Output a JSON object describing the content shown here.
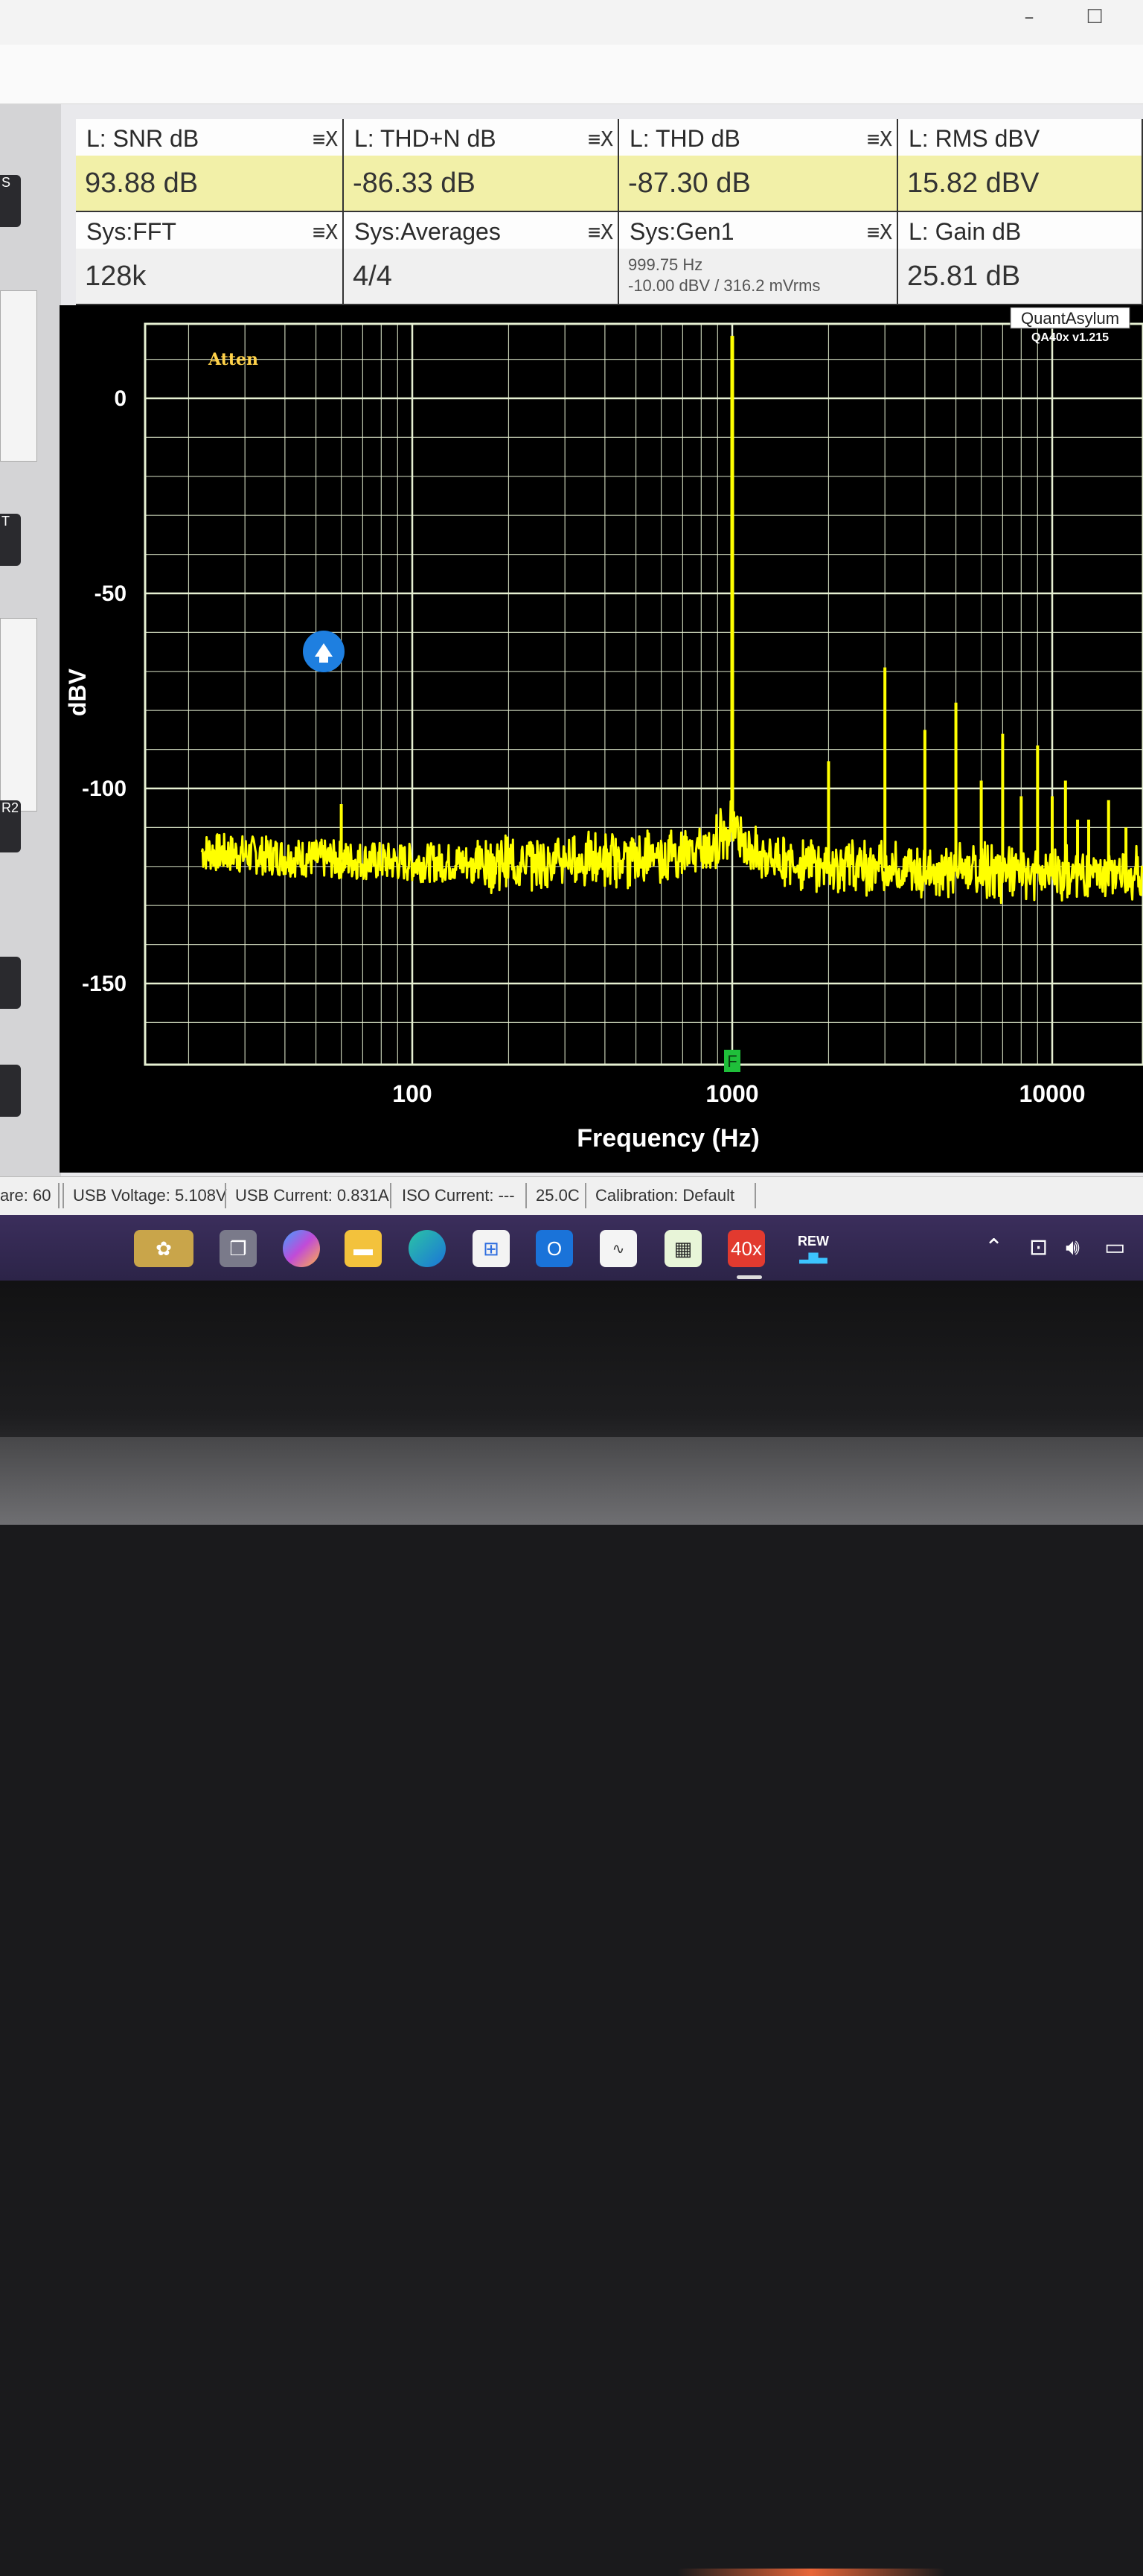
{
  "meters": [
    {
      "title": "L: SNR dB",
      "value": "93.88 dB",
      "style": "yellow"
    },
    {
      "title": "L: THD+N dB",
      "value": "-86.33 dB",
      "style": "yellow"
    },
    {
      "title": "L: THD dB",
      "value": "-87.30 dB",
      "style": "yellow"
    },
    {
      "title": "L: RMS dBV",
      "value": "15.82 dBV",
      "style": "yellow"
    },
    {
      "title": "Sys:FFT",
      "value": "128k",
      "style": "grey"
    },
    {
      "title": "Sys:Averages",
      "value": "4/4",
      "style": "grey"
    },
    {
      "title": "Sys:Gen1",
      "value_line1": "999.75 Hz",
      "value_line2": "-10.00 dBV  / 316.2 mVrms",
      "style": "grey"
    },
    {
      "title": "L: Gain dB",
      "value": "25.81 dB",
      "style": "grey"
    }
  ],
  "meter_ctrl": "≡X",
  "plot": {
    "atten_label": "Atten",
    "brand": "QuantAsylum",
    "version": "QA40x v1.215",
    "marker_label": "F",
    "ylabel": "dBV",
    "xlabel": "Frequency (Hz)",
    "ytick_labels": [
      "0",
      "-50",
      "-100",
      "-150"
    ],
    "xtick_labels": [
      "100",
      "1000",
      "10000"
    ]
  },
  "chart_data": {
    "type": "line",
    "xlabel": "Frequency (Hz)",
    "ylabel": "dBV",
    "x_scale": "log",
    "xlim": [
      20,
      20000
    ],
    "ylim": [
      -160,
      20
    ],
    "grid": true,
    "series": [
      {
        "color": "#ffff00",
        "noise_floor": [
          [
            20,
            -116
          ],
          [
            50,
            -118
          ],
          [
            100,
            -119
          ],
          [
            200,
            -119
          ],
          [
            500,
            -118
          ],
          [
            800,
            -116
          ],
          [
            950,
            -112
          ],
          [
            1000,
            -108
          ],
          [
            1050,
            -112
          ],
          [
            1200,
            -117
          ],
          [
            2000,
            -120
          ],
          [
            5000,
            -121
          ],
          [
            10000,
            -122
          ],
          [
            20000,
            -122
          ]
        ],
        "peaks": [
          [
            60,
            -104
          ],
          [
            1000,
            16
          ],
          [
            2000,
            -93
          ],
          [
            3000,
            -69
          ],
          [
            4000,
            -85
          ],
          [
            5000,
            -78
          ],
          [
            6000,
            -98
          ],
          [
            7000,
            -86
          ],
          [
            8000,
            -102
          ],
          [
            9000,
            -89
          ],
          [
            10000,
            -102
          ],
          [
            11000,
            -98
          ],
          [
            12000,
            -108
          ],
          [
            13000,
            -108
          ],
          [
            15000,
            -103
          ],
          [
            17000,
            -110
          ]
        ]
      }
    ]
  },
  "statusbar": {
    "items": [
      "are: 60",
      "USB Voltage: 5.108V",
      "USB Current: 0.831A",
      "ISO Current: ---",
      "25.0C",
      "Calibration: Default"
    ]
  },
  "taskbar": {
    "qa_label": "40x",
    "rew_label": "REW"
  },
  "colors": {
    "trace": "#ffff00",
    "grid": "#e6f0d2",
    "background": "#000000",
    "meter_highlight": "#f2f0a8"
  }
}
